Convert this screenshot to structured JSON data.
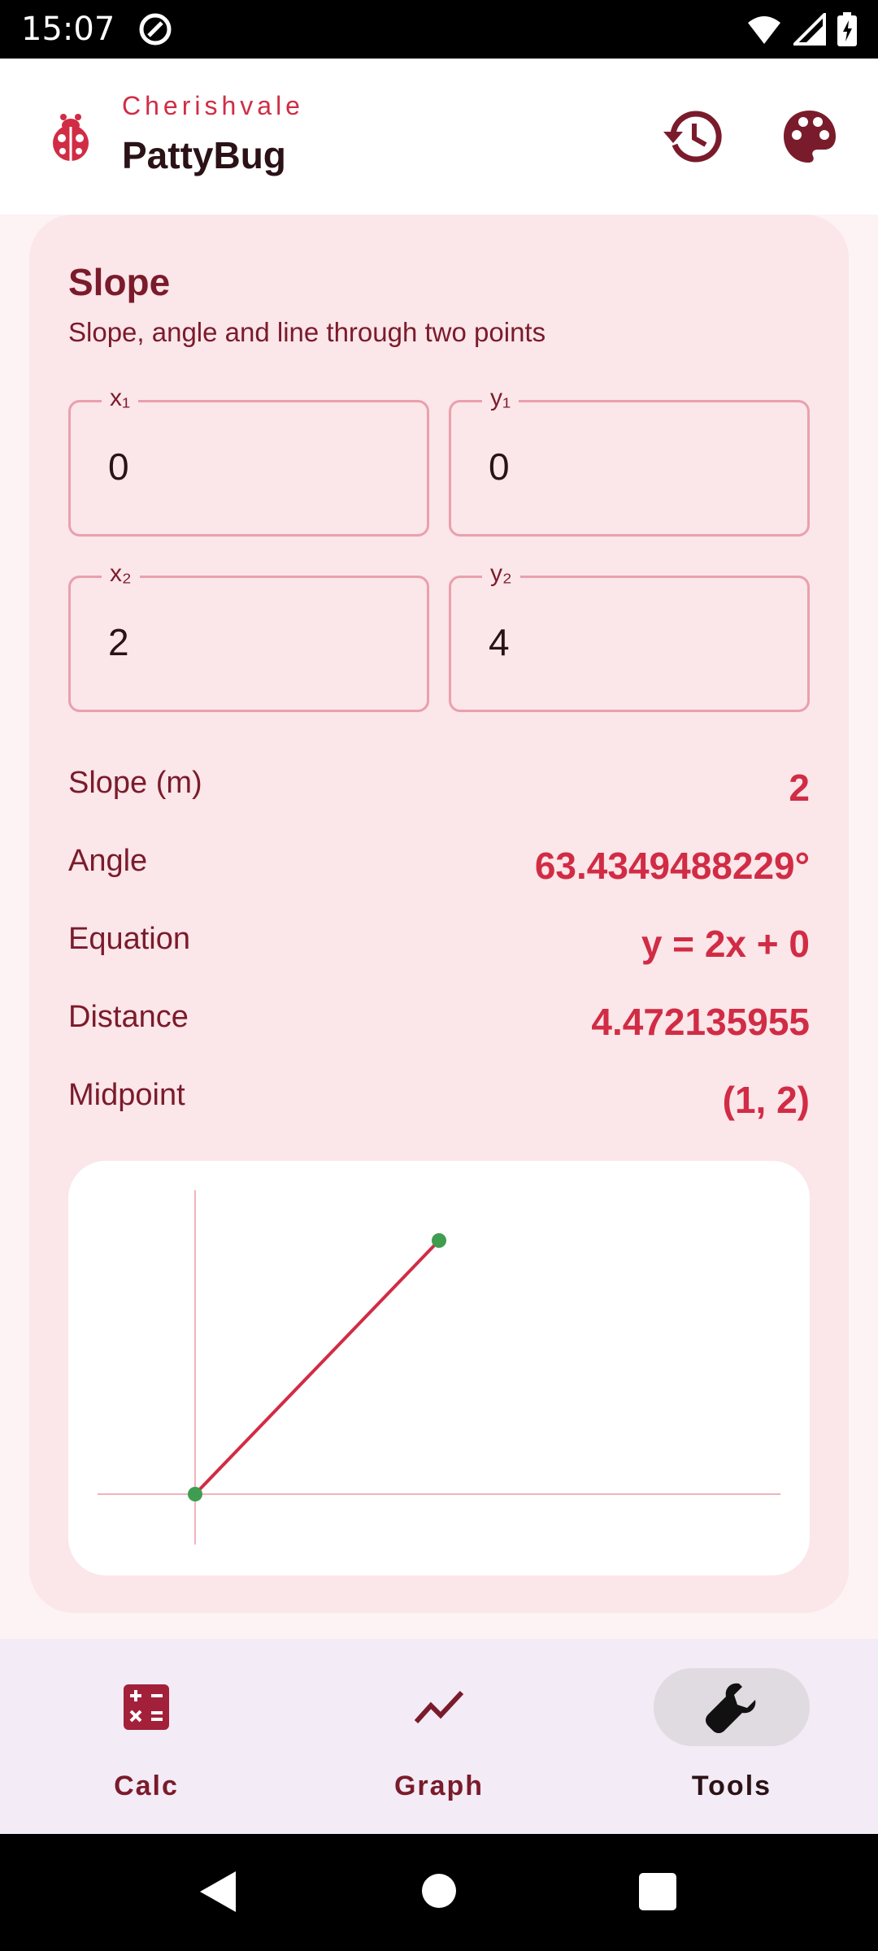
{
  "status_bar": {
    "time": "15:07"
  },
  "app_bar": {
    "subtitle": "Cherishvale",
    "title": "PattyBug"
  },
  "card": {
    "title": "Slope",
    "description": "Slope, angle and line through two points",
    "inputs": {
      "x1": {
        "label": "x₁",
        "value": "0"
      },
      "y1": {
        "label": "y₁",
        "value": "0"
      },
      "x2": {
        "label": "x₂",
        "value": "2"
      },
      "y2": {
        "label": "y₂",
        "value": "4"
      }
    },
    "results": [
      {
        "label": "Slope (m)",
        "value": "2"
      },
      {
        "label": "Angle",
        "value": "63.4349488229°"
      },
      {
        "label": "Equation",
        "value": "y = 2x + 0"
      },
      {
        "label": "Distance",
        "value": "4.472135955"
      },
      {
        "label": "Midpoint",
        "value": "(1, 2)"
      }
    ]
  },
  "chart_data": {
    "type": "line",
    "points": [
      {
        "x": 0,
        "y": 0
      },
      {
        "x": 2,
        "y": 4
      }
    ],
    "colors": {
      "line": "#d12c45",
      "point": "#3f9d4f",
      "axis": "#f0b3bd"
    }
  },
  "bottom_nav": {
    "items": [
      {
        "label": "Calc",
        "icon": "calculator-icon",
        "active": false
      },
      {
        "label": "Graph",
        "icon": "trending-line-icon",
        "active": false
      },
      {
        "label": "Tools",
        "icon": "wrench-icon",
        "active": true
      }
    ]
  },
  "colors": {
    "accent": "#d12c45",
    "dark_accent": "#7a1b2b",
    "card_bg": "#fbe6e9"
  }
}
